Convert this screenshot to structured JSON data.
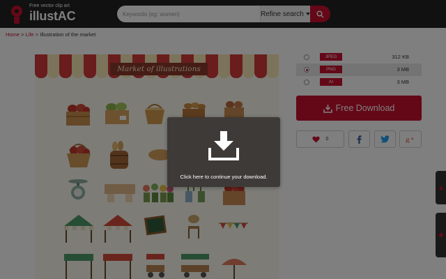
{
  "header": {
    "logo_tagline": "Free vector clip art",
    "logo_text": "illustAC",
    "search_placeholder": "Keywords (eg: women)",
    "refine_label": "Refine search",
    "search_icon": "magnifier-icon"
  },
  "breadcrumb": {
    "home": "Home",
    "separator": ">",
    "category": "Life",
    "current": "Illustration of the market"
  },
  "illustration": {
    "banner_text": "Market of illustrations"
  },
  "formats": [
    {
      "label": "JPEG",
      "size": "312 KB",
      "selected": false
    },
    {
      "label": "PNG",
      "size": "3 MB",
      "selected": true
    },
    {
      "label": "AI",
      "size": "3 MB",
      "selected": false
    }
  ],
  "download": {
    "label": "Free Download",
    "icon": "download-icon"
  },
  "social": {
    "like_count": "0",
    "like_icon": "heart-icon",
    "facebook_icon": "facebook-icon",
    "twitter_icon": "twitter-icon",
    "google_plus_icon": "google-plus-icon"
  },
  "overlay": {
    "message": "Click here to continue your download.",
    "icon": "download-icon"
  },
  "colors": {
    "header_bg": "#222222",
    "accent_red": "#c8102e",
    "modal_bg": "#3d3a38",
    "awning_red": "#d23a3a",
    "awning_cream": "#f6e6b4"
  }
}
